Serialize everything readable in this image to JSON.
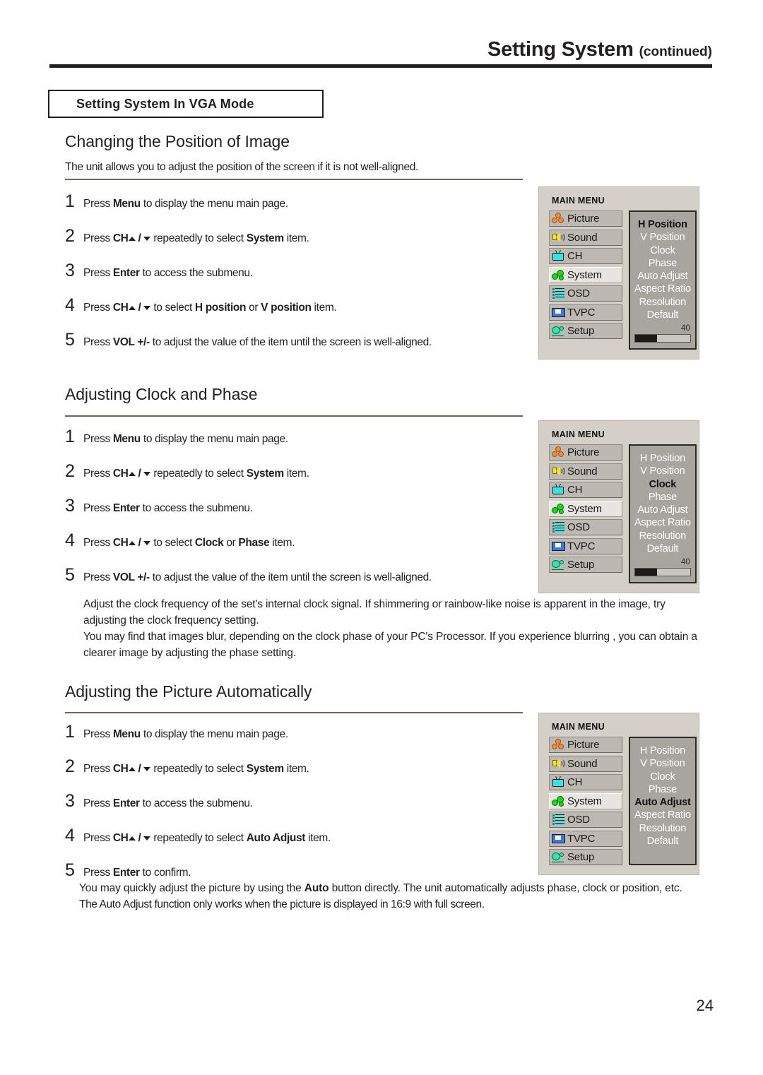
{
  "header": {
    "title": "Setting System",
    "continued": "(continued)"
  },
  "vga_box": {
    "label": "Setting System In VGA Mode"
  },
  "sections": [
    {
      "title": "Changing the Position of Image",
      "intro": "The unit allows you to adjust the position of the screen if it is not well-aligned.",
      "steps": [
        {
          "num": "1",
          "pre": "Press ",
          "bold1": "Menu",
          "mid": " to display the menu main page."
        },
        {
          "num": "2",
          "pre": "Press ",
          "bold1": "CH",
          "arrows": true,
          "mid": " repeatedly to select ",
          "bold2": "System",
          "post": " item."
        },
        {
          "num": "3",
          "pre": "Press ",
          "bold1": "Enter",
          "mid": " to access the submenu."
        },
        {
          "num": "4",
          "pre": "Press ",
          "bold1": "CH",
          "arrows": true,
          "mid": " to select ",
          "bold2": "H position",
          "mid2": " or ",
          "bold3": "V position",
          "post": " item."
        },
        {
          "num": "5",
          "pre": "Press ",
          "bold1": "VOL +/-",
          "mid": " to adjust the value of the item until the screen is well-aligned."
        }
      ]
    },
    {
      "title": "Adjusting Clock and Phase",
      "steps": [
        {
          "num": "1",
          "pre": "Press ",
          "bold1": "Menu",
          "mid": " to display the menu main page."
        },
        {
          "num": "2",
          "pre": "Press ",
          "bold1": "CH",
          "arrows": true,
          "mid": " repeatedly to select ",
          "bold2": "System",
          "post": " item."
        },
        {
          "num": "3",
          "pre": "Press ",
          "bold1": "Enter",
          "mid": " to access the submenu."
        },
        {
          "num": "4",
          "pre": "Press ",
          "bold1": "CH",
          "arrows": true,
          "mid": " to select ",
          "bold2": "Clock",
          "mid2": " or ",
          "bold3": "Phase",
          "post": " item."
        },
        {
          "num": "5",
          "pre": "Press ",
          "bold1": "VOL +/-",
          "mid": " to adjust the value of the item until the screen is well-aligned."
        }
      ],
      "notes": [
        "Adjust the clock frequency of the set's internal clock signal. If shimmering or rainbow-like noise is apparent in the image, try adjusting the clock frequency setting.",
        "You may find that images blur, depending on the clock phase of your PC's Processor. If you experience blurring , you can obtain a clearer image by adjusting the phase setting."
      ]
    },
    {
      "title": "Adjusting the Picture Automatically",
      "steps": [
        {
          "num": "1",
          "pre": "Press ",
          "bold1": "Menu",
          "mid": " to display the menu main page."
        },
        {
          "num": "2",
          "pre": "Press ",
          "bold1": "CH",
          "arrows": true,
          "mid": " repeatedly to select ",
          "bold2": "System",
          "post": " item."
        },
        {
          "num": "3",
          "pre": "Press ",
          "bold1": "Enter",
          "mid": " to access the submenu."
        },
        {
          "num": "4",
          "pre": "Press ",
          "bold1": "CH",
          "arrows": true,
          "mid": " repeatedly to select ",
          "bold2": "Auto Adjust",
          "post": " item."
        },
        {
          "num": "5",
          "pre": "Press ",
          "bold1": "Enter",
          "mid": " to confirm."
        }
      ],
      "notes_after": [
        {
          "pre": "You may quickly adjust the picture by using the ",
          "bold": "Auto",
          "post": " button directly. The unit automatically adjusts phase, clock or position, etc."
        },
        {
          "pre": "The Auto Adjust function only works when the picture is displayed in 16:9 with full screen.",
          "bold": "",
          "post": ""
        }
      ]
    }
  ],
  "osd_menus": [
    {
      "title": "MAIN MENU",
      "items": [
        {
          "label": "Picture",
          "icon": "picture-icon",
          "selected": false
        },
        {
          "label": "Sound",
          "icon": "sound-icon",
          "selected": false
        },
        {
          "label": "CH",
          "icon": "ch-icon",
          "selected": false
        },
        {
          "label": "System",
          "icon": "system-icon",
          "selected": true
        },
        {
          "label": "OSD",
          "icon": "osd-icon",
          "selected": false
        },
        {
          "label": "TVPC",
          "icon": "tvpc-icon",
          "selected": false
        },
        {
          "label": "Setup",
          "icon": "setup-icon",
          "selected": false
        }
      ],
      "submenu": [
        {
          "label": "H Position",
          "active": true
        },
        {
          "label": "V Position",
          "active": false
        },
        {
          "label": "Clock",
          "active": false
        },
        {
          "label": "Phase",
          "active": false
        },
        {
          "label": "Auto Adjust",
          "active": false
        },
        {
          "label": "Aspect Ratio",
          "active": false
        },
        {
          "label": "Resolution",
          "active": false
        },
        {
          "label": "Default",
          "active": false
        }
      ],
      "value": "40",
      "value_percent": 40,
      "has_bar": true
    },
    {
      "title": "MAIN MENU",
      "items": [
        {
          "label": "Picture",
          "icon": "picture-icon",
          "selected": false
        },
        {
          "label": "Sound",
          "icon": "sound-icon",
          "selected": false
        },
        {
          "label": "CH",
          "icon": "ch-icon",
          "selected": false
        },
        {
          "label": "System",
          "icon": "system-icon",
          "selected": true
        },
        {
          "label": "OSD",
          "icon": "osd-icon",
          "selected": false
        },
        {
          "label": "TVPC",
          "icon": "tvpc-icon",
          "selected": false
        },
        {
          "label": "Setup",
          "icon": "setup-icon",
          "selected": false
        }
      ],
      "submenu": [
        {
          "label": "H Position",
          "active": false
        },
        {
          "label": "V Position",
          "active": false
        },
        {
          "label": "Clock",
          "active": true
        },
        {
          "label": "Phase",
          "active": false
        },
        {
          "label": "Auto Adjust",
          "active": false
        },
        {
          "label": "Aspect Ratio",
          "active": false
        },
        {
          "label": "Resolution",
          "active": false
        },
        {
          "label": "Default",
          "active": false
        }
      ],
      "value": "40",
      "value_percent": 40,
      "has_bar": true
    },
    {
      "title": "MAIN MENU",
      "items": [
        {
          "label": "Picture",
          "icon": "picture-icon",
          "selected": false
        },
        {
          "label": "Sound",
          "icon": "sound-icon",
          "selected": false
        },
        {
          "label": "CH",
          "icon": "ch-icon",
          "selected": false
        },
        {
          "label": "System",
          "icon": "system-icon",
          "selected": true
        },
        {
          "label": "OSD",
          "icon": "osd-icon",
          "selected": false
        },
        {
          "label": "TVPC",
          "icon": "tvpc-icon",
          "selected": false
        },
        {
          "label": "Setup",
          "icon": "setup-icon",
          "selected": false
        }
      ],
      "submenu": [
        {
          "label": "H Position",
          "active": false
        },
        {
          "label": "V Position",
          "active": false
        },
        {
          "label": "Clock",
          "active": false
        },
        {
          "label": "Phase",
          "active": false
        },
        {
          "label": "Auto Adjust",
          "active": true
        },
        {
          "label": "Aspect Ratio",
          "active": false
        },
        {
          "label": "Resolution",
          "active": false
        },
        {
          "label": "Default",
          "active": false
        }
      ],
      "value": "",
      "value_percent": 0,
      "has_bar": false
    }
  ],
  "page_number": "24"
}
